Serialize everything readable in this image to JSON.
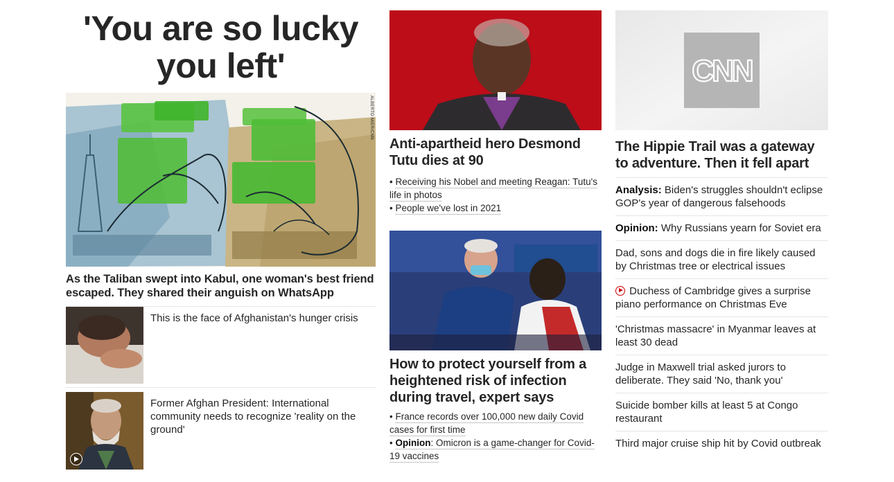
{
  "left": {
    "headline": "'You are so lucky you left'",
    "hero_credit": "ALBERTO MIER/CNN",
    "hero_title": "As the Taliban swept into Kabul, one woman's best friend escaped. They shared their anguish on WhatsApp",
    "stories": [
      {
        "title": "This is the face of Afghanistan's hunger crisis"
      },
      {
        "title": "Former Afghan President: International community needs to recognize 'reality on the ground'"
      }
    ]
  },
  "center": {
    "story1": {
      "title": "Anti-apartheid hero Desmond Tutu dies at 90",
      "related": [
        "Receiving his Nobel and meeting Reagan: Tutu's life in photos",
        "People we've lost in 2021"
      ]
    },
    "story2": {
      "title": "How to protect yourself from a heightened risk of infection during travel, expert says",
      "related": [
        {
          "prefix": "",
          "text": "France records over 100,000 new daily Covid cases for first time"
        },
        {
          "prefix": "Opinion",
          "text": ": Omicron is a game-changer for Covid-19 vaccines"
        }
      ]
    }
  },
  "right": {
    "logo_text": "CNN",
    "headline": "The Hippie Trail was a gateway to adventure. Then it fell apart",
    "items": [
      {
        "label": "Analysis:",
        "text": " Biden's struggles shouldn't eclipse GOP's year of dangerous falsehoods"
      },
      {
        "label": "Opinion:",
        "text": " Why Russians yearn for Soviet era"
      },
      {
        "label": "",
        "text": "Dad, sons and dogs die in fire likely caused by Christmas tree or electrical issues"
      },
      {
        "label": "",
        "text": " Duchess of Cambridge gives a surprise piano performance on Christmas Eve"
      },
      {
        "label": "",
        "text": "'Christmas massacre' in Myanmar leaves at least 30 dead"
      },
      {
        "label": "",
        "text": "Judge in Maxwell trial asked jurors to deliberate. They said 'No, thank you'"
      },
      {
        "label": "",
        "text": "Suicide bomber kills at least 5 at Congo restaurant"
      },
      {
        "label": "",
        "text": "Third major cruise ship hit by Covid outbreak"
      }
    ]
  }
}
